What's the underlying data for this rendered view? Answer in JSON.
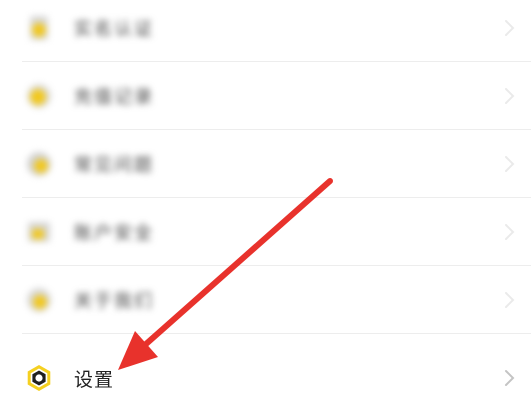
{
  "menu": {
    "items": [
      {
        "label": "实名认证",
        "icon": "user-badge-icon",
        "blurred": true
      },
      {
        "label": "充值记录",
        "icon": "coin-icon",
        "blurred": true
      },
      {
        "label": "常见问题",
        "icon": "help-icon",
        "blurred": true
      },
      {
        "label": "账户安全",
        "icon": "shield-icon",
        "blurred": true
      },
      {
        "label": "关于我们",
        "icon": "info-icon",
        "blurred": true
      },
      {
        "label": "设置",
        "icon": "settings-hexagon-icon",
        "blurred": false
      }
    ]
  },
  "colors": {
    "accent_yellow": "#f5d020",
    "arrow_red": "#e8322c",
    "chevron": "#c4c4c4",
    "text": "#222222"
  }
}
